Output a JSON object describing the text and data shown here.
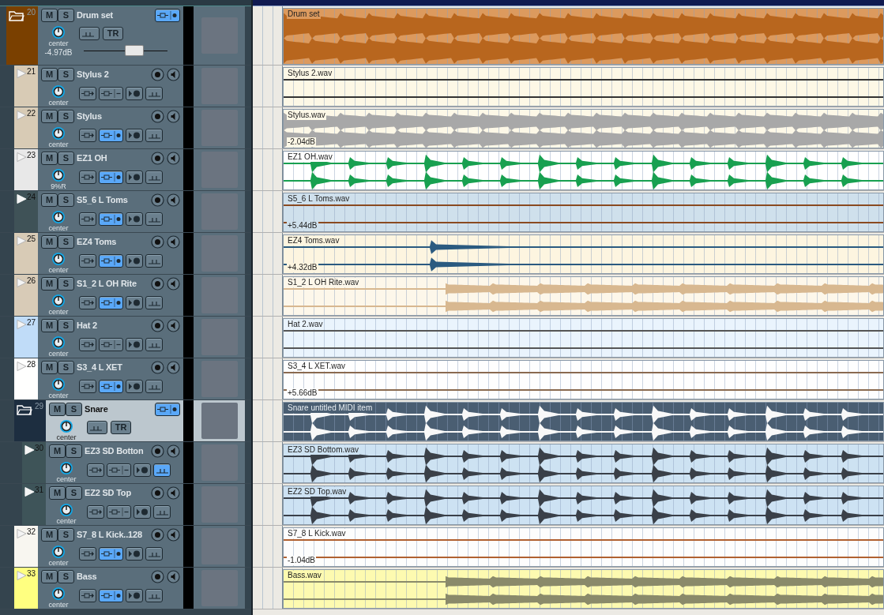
{
  "tracks": [
    {
      "number": "20",
      "name": "Drum set",
      "kind": "folder",
      "color": "#7a4000",
      "selected": false,
      "mute": "M",
      "solo": "S",
      "trim": "TR",
      "pan": "center",
      "volume": "-4.97dB",
      "level": 0.6,
      "monitor": true,
      "env": false,
      "item": {
        "name": "Drum set",
        "kind": "dense",
        "color": "#dc9a5e",
        "waveform": {
          "color": "#b8661e"
        }
      },
      "children": [
        {
          "number": "21",
          "name": "Stylus 2",
          "kind": "track",
          "color": "#d8cbb5",
          "selected": false,
          "mute": "M",
          "solo": "S",
          "pan": "center",
          "monitor": false,
          "env": false,
          "item": {
            "name": "Stylus 2.wav",
            "kind": "flat",
            "color": "#fdf8e6",
            "waveform": {
              "color": "#333333"
            }
          }
        },
        {
          "number": "22",
          "name": "Stylus",
          "kind": "track",
          "color": "#d8cbb5",
          "selected": false,
          "mute": "M",
          "solo": "S",
          "pan": "center",
          "monitor": true,
          "env": false,
          "item": {
            "name": "Stylus.wav",
            "kind": "dense",
            "color": "#fdf8e7",
            "waveform": {
              "color": "#a8a8a8"
            },
            "gain": "-2.04dB"
          }
        },
        {
          "number": "23",
          "name": "EZ1 OH",
          "kind": "track",
          "color": "#e8e8e8",
          "selected": false,
          "mute": "M",
          "solo": "S",
          "pan": "9%R",
          "monitor": true,
          "env": false,
          "item": {
            "name": "EZ1 OH.wav",
            "kind": "hits",
            "color": "#ffffff",
            "waveform": {
              "color": "#18a050"
            }
          }
        },
        {
          "number": "24",
          "name": "S5_6 L Toms",
          "kind": "track",
          "color": "#3f5257",
          "selected": false,
          "mute": "M",
          "solo": "S",
          "pan": "center",
          "monitor": true,
          "env": false,
          "item": {
            "name": "S5_6 L Toms.wav",
            "kind": "flat",
            "color": "#cfe0ec",
            "waveform": {
              "color": "#8a4a20"
            },
            "gain": "+5.44dB"
          }
        },
        {
          "number": "25",
          "name": "EZ4 Toms",
          "kind": "track",
          "color": "#d8cbb6",
          "selected": false,
          "mute": "M",
          "solo": "S",
          "pan": "center",
          "monitor": true,
          "env": false,
          "item": {
            "name": "EZ4 Toms.wav",
            "kind": "burst",
            "color": "#fdf5e0",
            "waveform": {
              "color": "#2a5a80"
            },
            "gain": "+4.32dB"
          }
        },
        {
          "number": "26",
          "name": "S1_2 L OH Rite",
          "kind": "track",
          "color": "#d8cbb7",
          "selected": false,
          "mute": "M",
          "solo": "S",
          "pan": "center",
          "monitor": true,
          "env": false,
          "item": {
            "name": "S1_2 L OH Rite.wav",
            "kind": "swell",
            "color": "#fdf7ea",
            "waveform": {
              "color": "#d8b890"
            }
          }
        },
        {
          "number": "27",
          "name": "Hat 2",
          "kind": "track",
          "color": "#c0dcf8",
          "selected": false,
          "mute": "M",
          "solo": "S",
          "pan": "center",
          "monitor": false,
          "env": false,
          "item": {
            "name": "Hat 2.wav",
            "kind": "flat",
            "color": "#eaf4fd",
            "waveform": {
              "color": "#555555"
            }
          }
        },
        {
          "number": "28",
          "name": "S3_4 L XET",
          "kind": "track",
          "color": "#fffffe",
          "selected": false,
          "mute": "M",
          "solo": "S",
          "pan": "center",
          "monitor": true,
          "env": false,
          "item": {
            "name": "S3_4 L XET.wav",
            "kind": "flat",
            "color": "#fefefe",
            "waveform": {
              "color": "#8a6a50"
            },
            "gain": "+5.66dB"
          }
        },
        {
          "number": "29",
          "name": "Snare",
          "kind": "folder",
          "color": "#1d2e40",
          "selected": true,
          "mute": "M",
          "solo": "S",
          "trim": "TR",
          "pan": "center",
          "monitor": true,
          "env": false,
          "item": {
            "name": "Snare untitled MIDI item",
            "kind": "hits",
            "color": "#4a5e72",
            "waveform": {
              "color": "#f8f8f8"
            }
          },
          "children": [
            {
              "number": "30",
              "name": "EZ3 SD Botton",
              "kind": "track",
              "color": "#3e5458",
              "selected": false,
              "mute": "M",
              "solo": "S",
              "pan": "center",
              "monitor": false,
              "env": true,
              "item": {
                "name": "EZ3 SD Bottom.wav",
                "kind": "hits",
                "color": "#cde2f2",
                "waveform": {
                  "color": "#3a4048"
                }
              }
            },
            {
              "number": "31",
              "name": "EZ2 SD Top",
              "kind": "track",
              "color": "#3e5459",
              "selected": false,
              "mute": "M",
              "solo": "S",
              "pan": "center",
              "monitor": false,
              "env": false,
              "item": {
                "name": "EZ2 SD Top.wav",
                "kind": "hits",
                "color": "#cde2f3",
                "waveform": {
                  "color": "#3a4049"
                }
              }
            }
          ]
        },
        {
          "number": "32",
          "name": "S7_8 L Kick..128",
          "kind": "track",
          "color": "#f8f6f0",
          "selected": false,
          "mute": "M",
          "solo": "S",
          "pan": "center",
          "monitor": true,
          "env": false,
          "item": {
            "name": "S7_8 L Kick.wav",
            "kind": "flat",
            "color": "#fdfdfd",
            "waveform": {
              "color": "#b06030"
            },
            "gain": "-1.04dB"
          }
        },
        {
          "number": "33",
          "name": "Bass",
          "kind": "track",
          "color": "#ffff80",
          "selected": false,
          "mute": "M",
          "solo": "S",
          "pan": "center",
          "monitor": true,
          "env": false,
          "item": {
            "name": "Bass.wav",
            "kind": "swell",
            "color": "#fdfab0",
            "waveform": {
              "color": "#8a8a6a"
            }
          }
        }
      ]
    }
  ]
}
